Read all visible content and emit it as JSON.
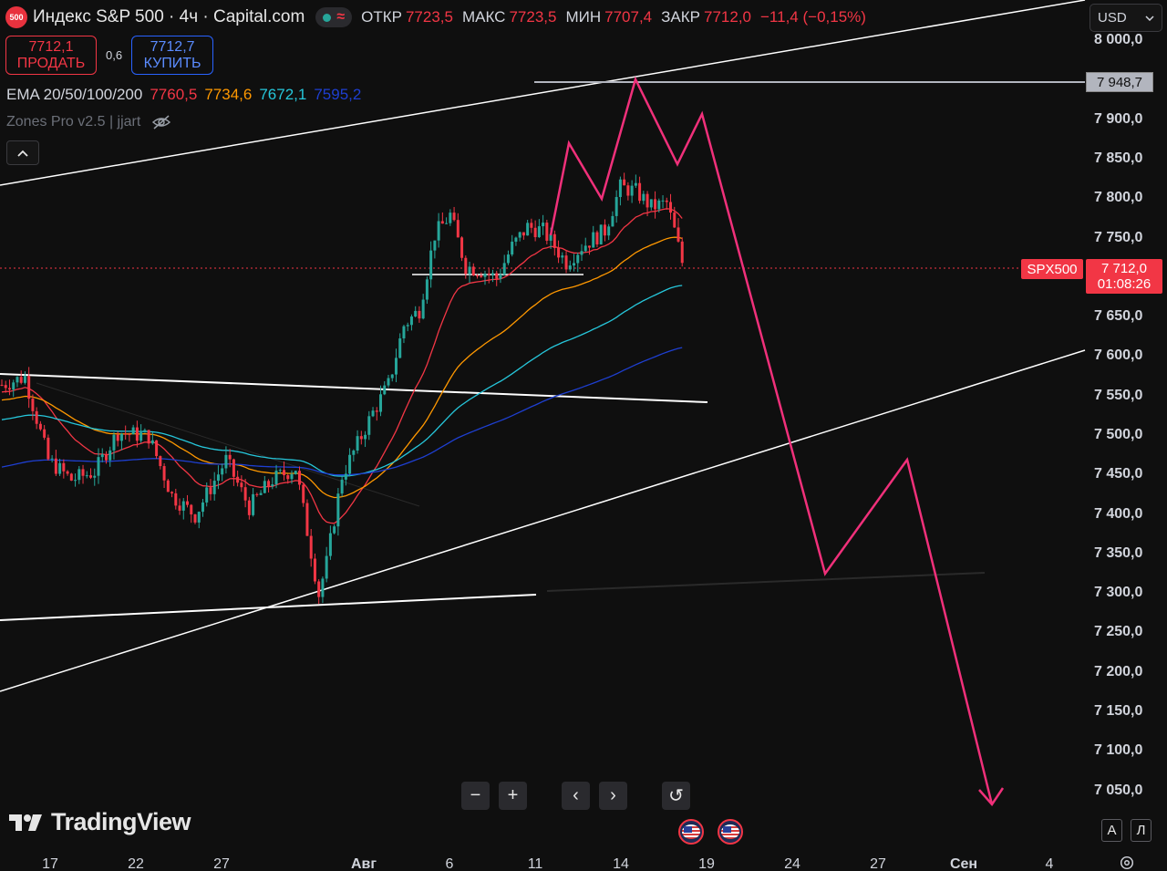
{
  "header": {
    "symbol_icon_text": "500",
    "title": "Индекс S&P 500 · 4ч · Capital.com",
    "status_icon": "wave-icon",
    "ohlc": [
      {
        "label": "ОТКР",
        "value": "7723,5"
      },
      {
        "label": "МАКС",
        "value": "7723,5"
      },
      {
        "label": "МИН",
        "value": "7707,4"
      },
      {
        "label": "ЗАКР",
        "value": "7712,0"
      }
    ],
    "change": "−11,4 (−0,15%)"
  },
  "trade": {
    "sell_price": "7712,1",
    "sell_label": "ПРОДАТЬ",
    "spread": "0,6",
    "buy_price": "7712,7",
    "buy_label": "КУПИТЬ"
  },
  "indicators": {
    "ema_label": "EMA 20/50/100/200",
    "ema_values": [
      {
        "value": "7760,5",
        "color": "#f23645"
      },
      {
        "value": "7734,6",
        "color": "#ff9800"
      },
      {
        "value": "7672,1",
        "color": "#26c6da"
      },
      {
        "value": "7595,2",
        "color": "#1e3fd1"
      }
    ],
    "zones_label": "Zones Pro v2.5 | jjart"
  },
  "currency": "USD",
  "price_axis": {
    "ticks": [
      "8 000,0",
      "7 900,0",
      "7 850,0",
      "7 800,0",
      "7 750,0",
      "7 650,0",
      "7 600,0",
      "7 550,0",
      "7 500,0",
      "7 450,0",
      "7 400,0",
      "7 350,0",
      "7 300,0",
      "7 250,0",
      "7 200,0",
      "7 150,0",
      "7 100,0",
      "7 050,0"
    ],
    "horizontal_line_label": "7 948,7",
    "symbol_tag": "SPX500",
    "last_price": "7 712,0",
    "countdown": "01:08:26"
  },
  "time_axis": {
    "ticks": [
      "17",
      "22",
      "27",
      "Авг",
      "6",
      "11",
      "14",
      "19",
      "24",
      "27",
      "Сен",
      "4"
    ]
  },
  "zoom_controls": [
    "−",
    "+",
    "‹",
    "›",
    "↺"
  ],
  "brand": "TradingView",
  "scale_buttons": [
    "A",
    "Л"
  ],
  "colors": {
    "up": "#26a69a",
    "down": "#f23645",
    "projection": "#f0307a",
    "background": "#0f0f0f"
  },
  "chart_data": {
    "type": "candlestick",
    "title": "",
    "timeframe": "4h",
    "ylim": [
      7020,
      8025
    ],
    "x_unit": "4h bars",
    "ema_series": [
      {
        "name": "EMA 20",
        "color": "#f23645",
        "last": 7760.5
      },
      {
        "name": "EMA 50",
        "color": "#ff9800",
        "last": 7734.6
      },
      {
        "name": "EMA 100",
        "color": "#26c6da",
        "last": 7672.1
      },
      {
        "name": "EMA 200",
        "color": "#1e3fd1",
        "last": 7595.2
      }
    ],
    "horizontal_line": 7948.7,
    "last_price": 7712.0
  }
}
